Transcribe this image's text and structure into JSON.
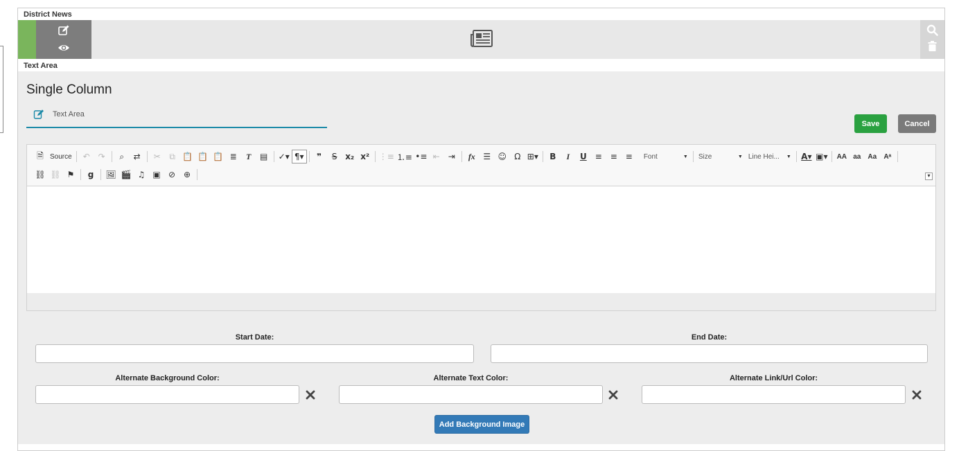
{
  "top_section": {
    "label": "District News"
  },
  "text_section": {
    "label": "Text Area"
  },
  "editor": {
    "title": "Single Column",
    "name_value": "Text Area",
    "save_label": "Save",
    "cancel_label": "Cancel"
  },
  "toolbar": {
    "source_label": "Source",
    "font_label": "Font",
    "size_label": "Size",
    "line_height_label": "Line Hei..."
  },
  "fields": {
    "start_date_label": "Start Date:",
    "end_date_label": "End Date:",
    "alt_bg_label": "Alternate Background Color:",
    "alt_text_label": "Alternate Text Color:",
    "alt_link_label": "Alternate Link/Url Color:",
    "start_date_value": "",
    "end_date_value": "",
    "alt_bg_value": "",
    "alt_text_value": "",
    "alt_link_value": "",
    "add_bg_button": "Add Background Image"
  },
  "colors": {
    "green_strip": "#7ab55c",
    "save_button": "#2aa140",
    "cancel_button": "#7a7a7a",
    "primary_button": "#337ab7",
    "accent_underline": "#1c8aa8"
  }
}
